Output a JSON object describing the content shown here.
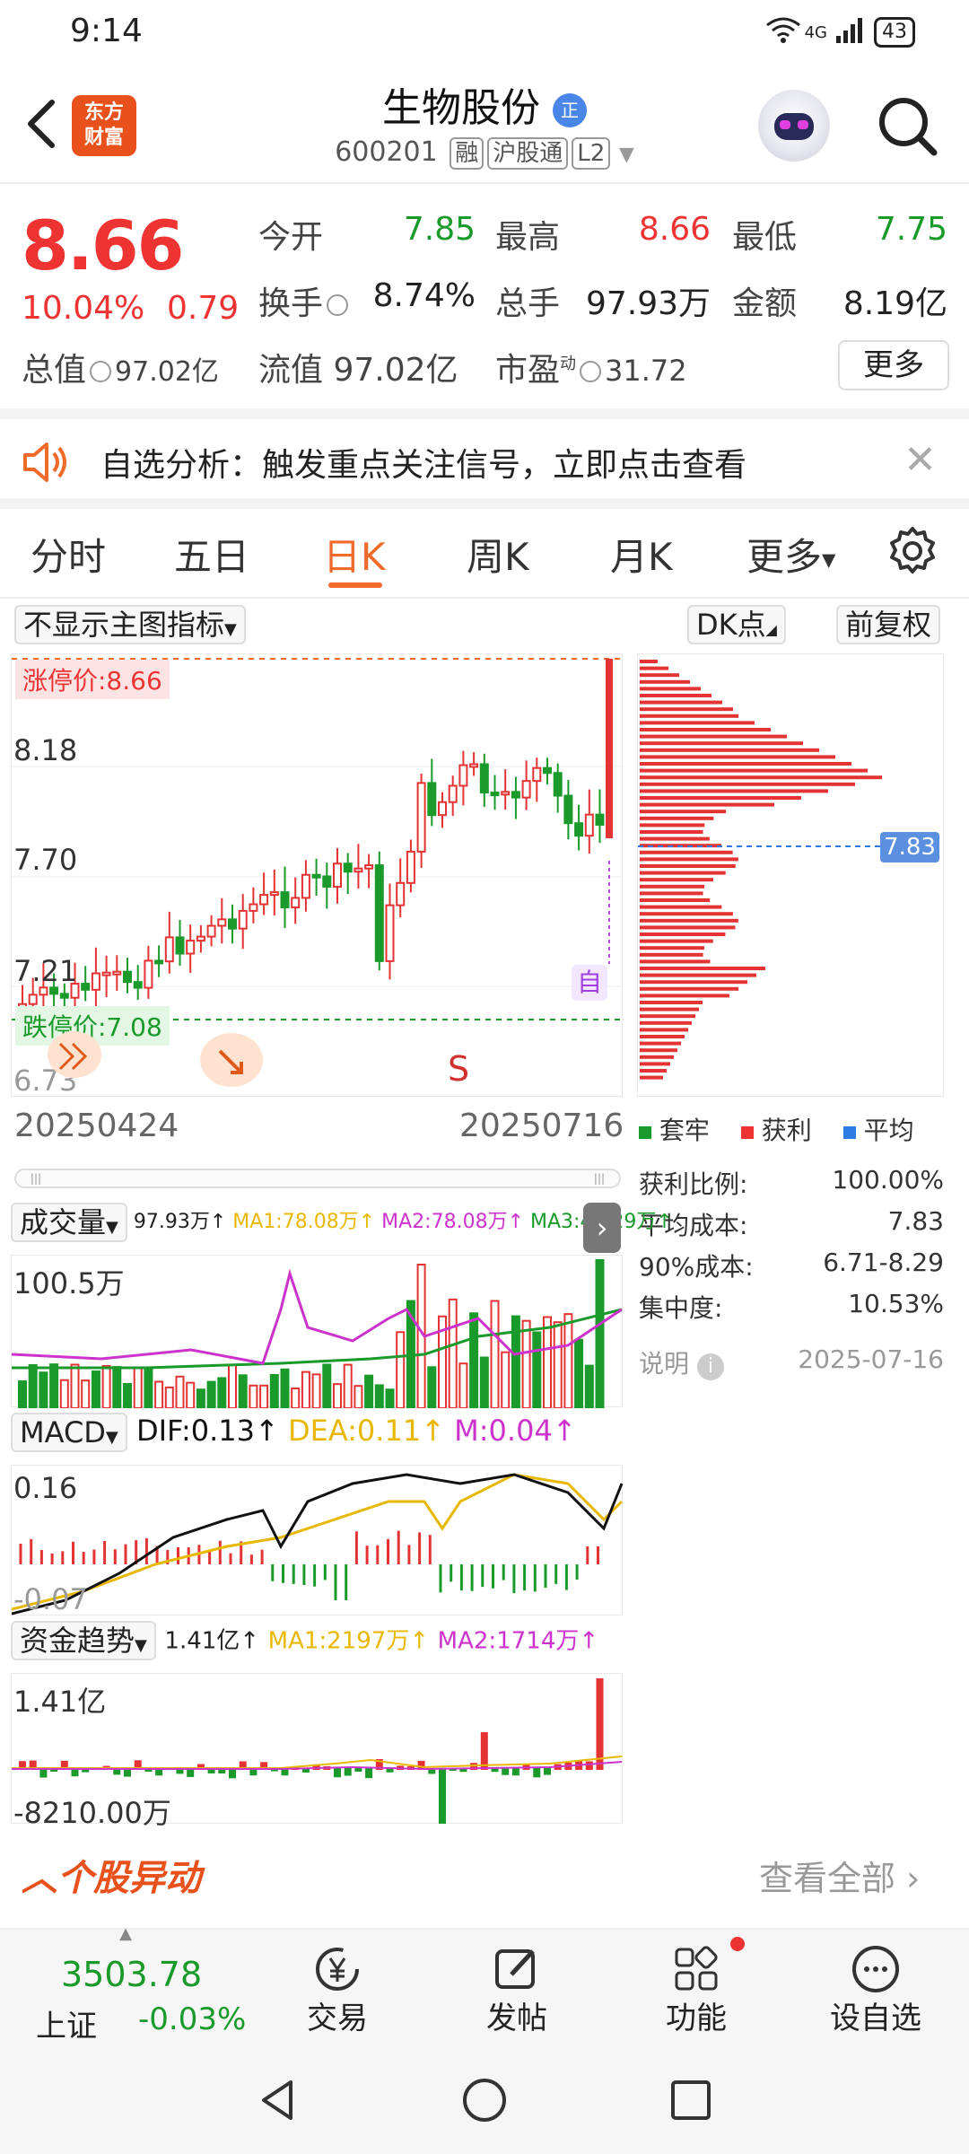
{
  "status_bar": {
    "time": "9:14",
    "network": "4G",
    "battery": "43"
  },
  "header": {
    "logo_text_1": "东方",
    "logo_text_2": "财富",
    "stock_name": "生物股份",
    "zheng_badge": "正",
    "stock_code": "600201",
    "tag_rong": "融",
    "tag_hgt": "沪股通",
    "tag_l2": "L2"
  },
  "quote": {
    "price": "8.66",
    "change_pct": "10.04%",
    "change_amt": "0.79",
    "open_label": "今开",
    "open": "7.85",
    "high_label": "最高",
    "high": "8.66",
    "low_label": "最低",
    "low": "7.75",
    "turnover_label": "换手",
    "turnover": "8.74%",
    "volume_label": "总手",
    "volume": "97.93万",
    "amount_label": "金额",
    "amount": "8.19亿",
    "mktcap_label": "总值",
    "mktcap": "97.02亿",
    "float_label": "流值",
    "float_cap": "97.02亿",
    "pe_label": "市盈",
    "pe_sup": "动",
    "pe": "31.72",
    "more_label": "更多"
  },
  "notice": {
    "text": "自选分析：触发重点关注信号，立即点击查看"
  },
  "tabs": [
    {
      "label": "分时"
    },
    {
      "label": "五日"
    },
    {
      "label": "日K"
    },
    {
      "label": "周K"
    },
    {
      "label": "月K"
    },
    {
      "label": "更多"
    }
  ],
  "chart_controls": {
    "indicator_select": "不显示主图指标",
    "dk_label": "DK点",
    "adjust_label": "前复权"
  },
  "kline": {
    "y_labels": [
      "8.66",
      "8.18",
      "7.70",
      "7.21",
      "6.73"
    ],
    "limit_up_label": "涨停价:8.66",
    "limit_down_label": "跌停价:7.08",
    "zi_badge": "自",
    "s_marker": "S",
    "date_start": "20250424",
    "date_end": "20250716",
    "cost_price_tag": "7.83"
  },
  "chip": {
    "legend": [
      {
        "label": "套牢",
        "color": "#1a9a2b"
      },
      {
        "label": "获利",
        "color": "#e33"
      },
      {
        "label": "平均",
        "color": "#2e7be6"
      }
    ],
    "stats": [
      {
        "label": "获利比例:",
        "value": "100.00%"
      },
      {
        "label": "平均成本:",
        "value": "7.83"
      },
      {
        "label": "90%成本:",
        "value": "6.71-8.29"
      },
      {
        "label": "集中度:",
        "value": "10.53%"
      }
    ],
    "note_label": "说明",
    "note_date": "2025-07-16"
  },
  "volume": {
    "select": "成交量",
    "value": "97.93万↑",
    "ma1": "MA1:78.08万↑",
    "ma2": "MA2:78.08万↑",
    "ma3": "MA3:44.29万↑",
    "y_top": "100.5万"
  },
  "macd": {
    "select": "MACD",
    "dif": "DIF:0.13↑",
    "dea": "DEA:0.11↑",
    "m": "M:0.04↑",
    "y_top": "0.16",
    "y_bottom": "-0.07"
  },
  "fund": {
    "select": "资金趋势",
    "value": "1.41亿↑",
    "ma1": "MA1:2197万↑",
    "ma2": "MA2:1714万↑",
    "y_top": "1.41亿",
    "y_bottom": "-8210.00万"
  },
  "movement": {
    "title": "个股异动",
    "view_all": "查看全部"
  },
  "bottom_nav": {
    "index_value": "3503.78",
    "index_name": "上证",
    "index_change": "-0.03%",
    "trade": "交易",
    "post": "发帖",
    "features": "功能",
    "watchlist": "设自选"
  },
  "colors": {
    "up": "#e33333",
    "down": "#1a9a2b",
    "accent": "#f06a2a",
    "dif": "#111111",
    "dea": "#e8b800",
    "m": "#cc33cc"
  }
}
